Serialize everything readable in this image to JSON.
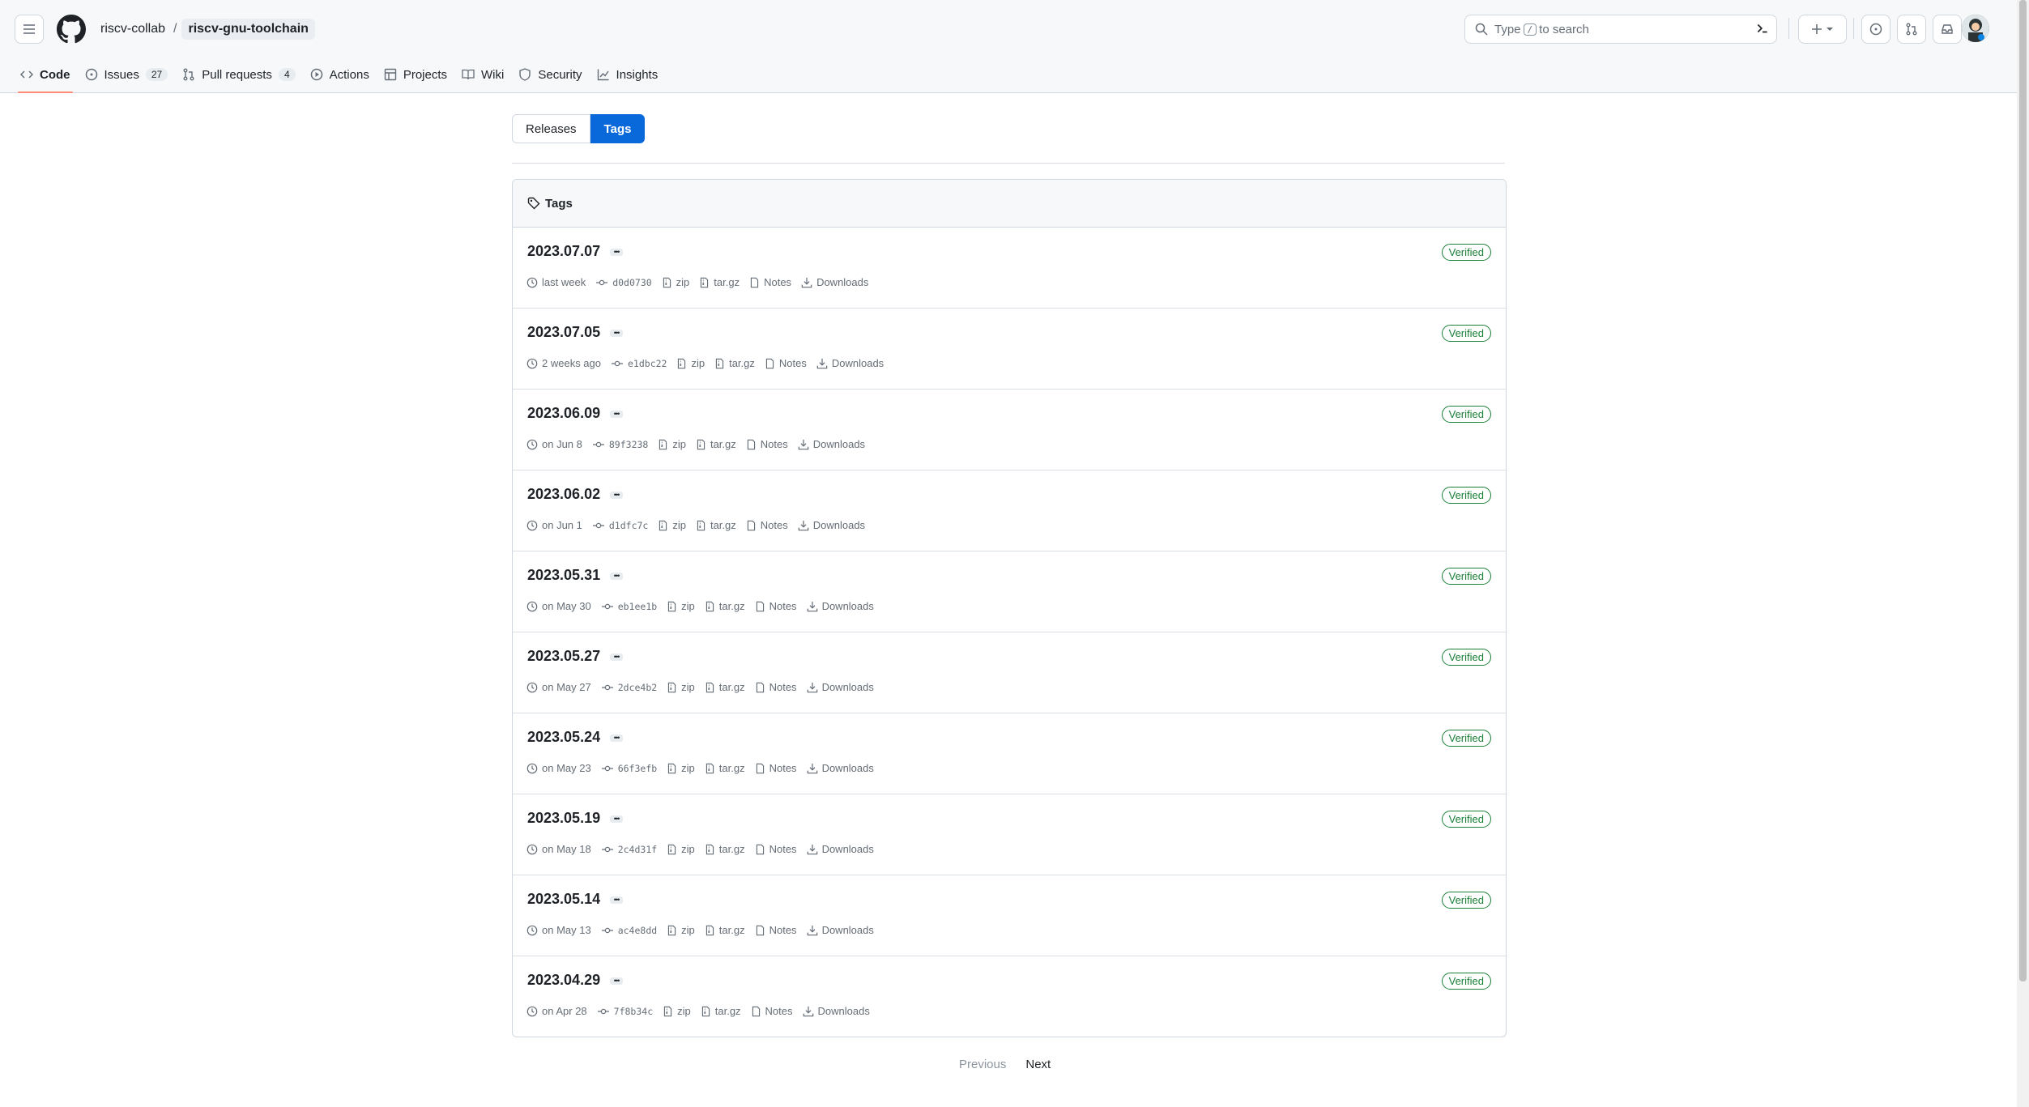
{
  "header": {
    "owner": "riscv-collab",
    "separator": "/",
    "repo": "riscv-gnu-toolchain",
    "search_prefix": "Type",
    "search_key": "/",
    "search_suffix": "to search"
  },
  "nav": [
    {
      "label": "Code",
      "icon": "code-icon"
    },
    {
      "label": "Issues",
      "icon": "issue-icon",
      "count": "27"
    },
    {
      "label": "Pull requests",
      "icon": "pull-request-icon",
      "count": "4"
    },
    {
      "label": "Actions",
      "icon": "play-icon"
    },
    {
      "label": "Projects",
      "icon": "table-icon"
    },
    {
      "label": "Wiki",
      "icon": "book-icon"
    },
    {
      "label": "Security",
      "icon": "shield-icon"
    },
    {
      "label": "Insights",
      "icon": "graph-icon"
    }
  ],
  "subnav": {
    "releases": "Releases",
    "tags": "Tags"
  },
  "box_title": "Tags",
  "labels": {
    "zip": "zip",
    "targz": "tar.gz",
    "notes": "Notes",
    "downloads": "Downloads",
    "verified": "Verified"
  },
  "tags": [
    {
      "name": "2023.07.07",
      "date": "last week",
      "sha": "d0d0730"
    },
    {
      "name": "2023.07.05",
      "date": "2 weeks ago",
      "sha": "e1dbc22"
    },
    {
      "name": "2023.06.09",
      "date": "on Jun 8",
      "sha": "89f3238"
    },
    {
      "name": "2023.06.02",
      "date": "on Jun 1",
      "sha": "d1dfc7c"
    },
    {
      "name": "2023.05.31",
      "date": "on May 30",
      "sha": "eb1ee1b"
    },
    {
      "name": "2023.05.27",
      "date": "on May 27",
      "sha": "2dce4b2"
    },
    {
      "name": "2023.05.24",
      "date": "on May 23",
      "sha": "66f3efb"
    },
    {
      "name": "2023.05.19",
      "date": "on May 18",
      "sha": "2c4d31f"
    },
    {
      "name": "2023.05.14",
      "date": "on May 13",
      "sha": "ac4e8dd"
    },
    {
      "name": "2023.04.29",
      "date": "on Apr 28",
      "sha": "7f8b34c"
    }
  ],
  "pagination": {
    "previous": "Previous",
    "next": "Next"
  },
  "colors": {
    "accent": "#0969da",
    "verified": "#1a7f37",
    "active_tab": "#fd8c73"
  }
}
